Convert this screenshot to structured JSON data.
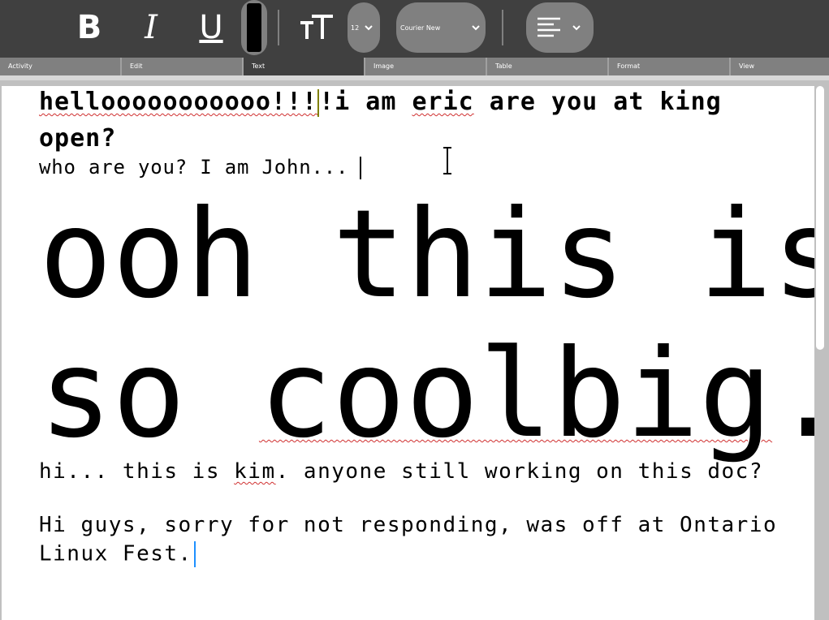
{
  "toolbar": {
    "bold_label": "B",
    "italic_label": "I",
    "underline_label": "U",
    "text_color": "#000000",
    "font_size_value": "12",
    "font_family_value": "Courier New",
    "icons": [
      "textsize-icon",
      "chevron-down-icon",
      "align-left-icon"
    ]
  },
  "tabs": [
    {
      "label": "Activity"
    },
    {
      "label": "Edit"
    },
    {
      "label": "Text"
    },
    {
      "label": "Image"
    },
    {
      "label": "Table"
    },
    {
      "label": "Format"
    },
    {
      "label": "View"
    }
  ],
  "active_tab": "Text",
  "document": {
    "line1_a": "hellooooooooooo!!!",
    "line1_b": "!i am ",
    "line1_c": "eric",
    "line1_d": " are you at king",
    "line2": "open?",
    "line3": "who are you? I am John...",
    "line4": "ooh this is",
    "line5_a": "so ",
    "line5_b": "coolbig",
    "line5_c": ".",
    "line6_a": "hi... this is ",
    "line6_b": "kim",
    "line6_c": ". anyone still working on this doc?",
    "line7": "Hi guys, sorry for not responding, was off at Ontario",
    "line8": "Linux Fest."
  },
  "colors": {
    "toolbar_bg": "#404040",
    "pill_bg": "#808080",
    "spell_error": "#d03030",
    "caret_other": "#808000",
    "caret_self": "#1e90ff"
  }
}
